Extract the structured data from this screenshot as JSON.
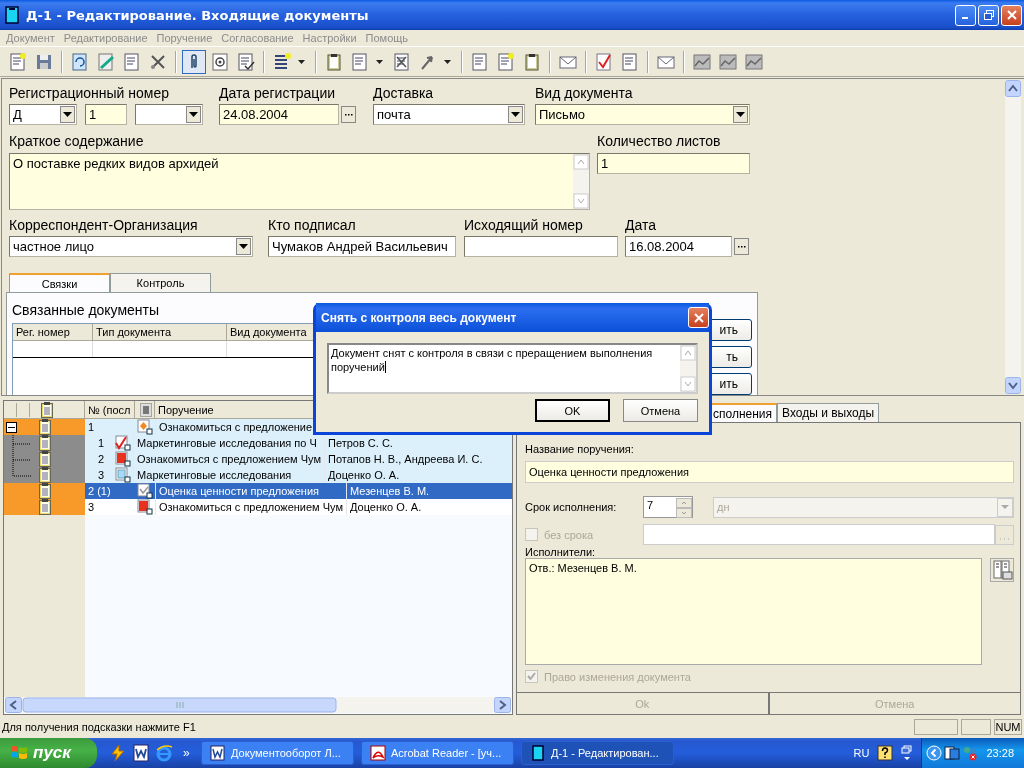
{
  "window": {
    "title": "Д-1 - Редактирование. Входящие документы"
  },
  "menu": [
    "Документ",
    "Редактирование",
    "Поручение",
    "Согласование",
    "Настройки",
    "Помощь"
  ],
  "form": {
    "rows": [
      [
        {
          "label": "Регистрационный номер",
          "controls": [
            {
              "kind": "combo",
              "value": "Д",
              "highlighted": false
            },
            {
              "kind": "text",
              "value": "1",
              "highlighted": true
            },
            {
              "kind": "combo",
              "highlighted": false
            }
          ]
        },
        {
          "label": "Дата регистрации",
          "controls": [
            {
              "kind": "date",
              "value": "24.08.2004",
              "highlighted": true
            }
          ]
        },
        {
          "label": "Доставка",
          "controls": [
            {
              "kind": "combo",
              "value": "почта",
              "highlighted": false
            }
          ]
        },
        {
          "label": "Вид документа",
          "controls": [
            {
              "kind": "combo",
              "value": "Письмо",
              "highlighted": true
            }
          ]
        }
      ],
      [
        {
          "label": "Краткое содержание",
          "controls": [
            {
              "kind": "memo",
              "value": "О поставке редких видов архидей",
              "highlighted": true
            }
          ]
        },
        {
          "label": "Количество листов",
          "controls": [
            {
              "kind": "text",
              "value": "1",
              "highlighted": true
            }
          ]
        }
      ],
      [
        {
          "label": "Корреспондент-Организация",
          "controls": [
            {
              "kind": "combo",
              "value": "частное лицо",
              "highlighted": false
            }
          ]
        },
        {
          "label": "Кто подписал",
          "controls": [
            {
              "kind": "text",
              "value": "Чумаков Андрей Васильевич",
              "highlighted": false
            }
          ]
        },
        {
          "label": "Исходящий номер",
          "controls": [
            {
              "kind": "text",
              "highlighted": false
            }
          ]
        },
        {
          "label": "Дата",
          "controls": [
            {
              "kind": "date",
              "value": "16.08.2004",
              "highlighted": false
            }
          ]
        }
      ]
    ]
  },
  "tabs": [
    {
      "label": "Связки",
      "selected": true
    },
    {
      "label": "Контроль",
      "selected": false
    }
  ],
  "linked": {
    "title": "Связанные документы",
    "columns": [
      "Рег. номер",
      "Тип документа",
      "Вид документа"
    ],
    "buttons": [
      "ить",
      "ть",
      "ить"
    ]
  },
  "grid": {
    "columns": [
      "№ (посл",
      "Поручение"
    ],
    "rows": [
      {
        "number": "1",
        "kind": "diamond",
        "task": "Ознакомиться с предложение",
        "selected": false,
        "expanded": true,
        "children": [
          {
            "number": "1",
            "kind": "check",
            "task": "Маркетинговые исследования по Ч",
            "executor": "Петров С. С.",
            "selected": false
          },
          {
            "number": "2",
            "kind": "red",
            "task": "Ознакомиться с предложением Чум",
            "executor": "Потапов Н. В., Андреева И. С.",
            "selected": false
          },
          {
            "number": "3",
            "kind": "blue",
            "task": "Маркетинговые исследования",
            "executor": "Доценко О. А.",
            "selected": false
          }
        ]
      },
      {
        "number": "2 (1)",
        "kind": "grey",
        "task": "Оценка ценности предложения",
        "executor": "Мезенцев В. М.",
        "selected": true
      },
      {
        "number": "3",
        "kind": "red",
        "task": "Ознакомиться с предложением Чум",
        "executor": "Доценко О. А.",
        "selected": false
      }
    ]
  },
  "task_panel": {
    "tabs": [
      {
        "label": "сполнения",
        "selected": true
      },
      {
        "label": "Входы и выходы",
        "selected": false
      }
    ],
    "name_label": "Название поручения:",
    "name_value": "Оценка ценности предложения",
    "due_label": "Срок исполнения:",
    "due_value": "7",
    "due_unit": "дн",
    "due_unit_disabled": true,
    "no_deadline": {
      "label": "без срока",
      "checked": false,
      "disabled": true
    },
    "executors_label": "Исполнители:",
    "executors_value": "Отв.: Мезенцев В. М.",
    "right_to_change": {
      "label": "Право изменения документа",
      "checked": true,
      "disabled": true
    },
    "buttons": [
      {
        "label": "Ok",
        "disabled": true
      },
      {
        "label": "Отмена",
        "disabled": true
      }
    ]
  },
  "dialog": {
    "title": "Снять с контроля весь документ",
    "message": "Документ снят с контроля в связи с  преращением выполнения поручений",
    "buttons": [
      {
        "label": "OK",
        "default": true
      },
      {
        "label": "Отмена",
        "default": false
      }
    ]
  },
  "status_bar": {
    "text": "Для получения подсказки нажмите F1",
    "indicators": [
      "NUM"
    ]
  },
  "taskbar": {
    "start": "пуск",
    "more": "»",
    "tasks": [
      {
        "label": "Документооборот Л...",
        "kind": "word",
        "selected": false
      },
      {
        "label": "Acrobat Reader - [уч...",
        "kind": "pdf",
        "selected": false
      },
      {
        "label": "Д-1 - Редактирован...",
        "kind": "app",
        "selected": true
      }
    ],
    "language": "RU",
    "time": "23:28"
  }
}
